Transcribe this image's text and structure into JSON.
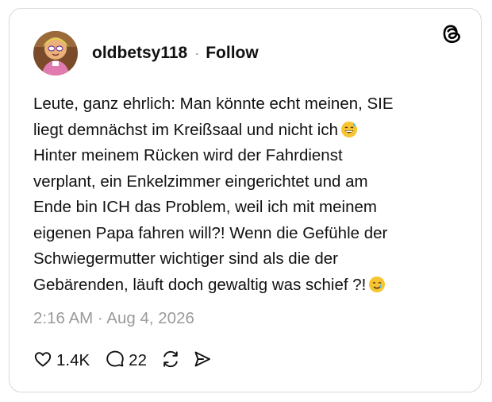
{
  "post": {
    "username": "oldbetsy118",
    "separator": "·",
    "follow_label": "Follow",
    "text_lines": [
      "Leute, ganz ehrlich: Man könnte echt meinen, SIE",
      "liegt demnächst im Kreißsaal und nicht ich",
      "Hinter meinem Rücken wird der Fahrdienst",
      "verplant, ein Enkelzimmer eingerichtet und am",
      "Ende bin ICH das Problem, weil ich mit meinem",
      "eigenen Papa fahren will?! Wenn die Gefühle der",
      "Schwiegermutter wichtiger sind als die der",
      "Gebärenden, läuft doch gewaltig was schief ?!"
    ],
    "emojis": [
      "grinning-face-with-sweat-emoji",
      "smiling-face-with-tear-emoji"
    ],
    "timestamp": "2:16 AM · Aug 4, 2026"
  },
  "actions": {
    "like_count": "1.4K",
    "reply_count": "22"
  },
  "icons": {
    "brand": "threads-logo-icon",
    "like": "heart-icon",
    "reply": "speech-bubble-icon",
    "repost": "repost-icon",
    "share": "send-icon"
  },
  "colors": {
    "text": "#111111",
    "muted": "#9b9b9b",
    "border": "#d9d9d9"
  }
}
